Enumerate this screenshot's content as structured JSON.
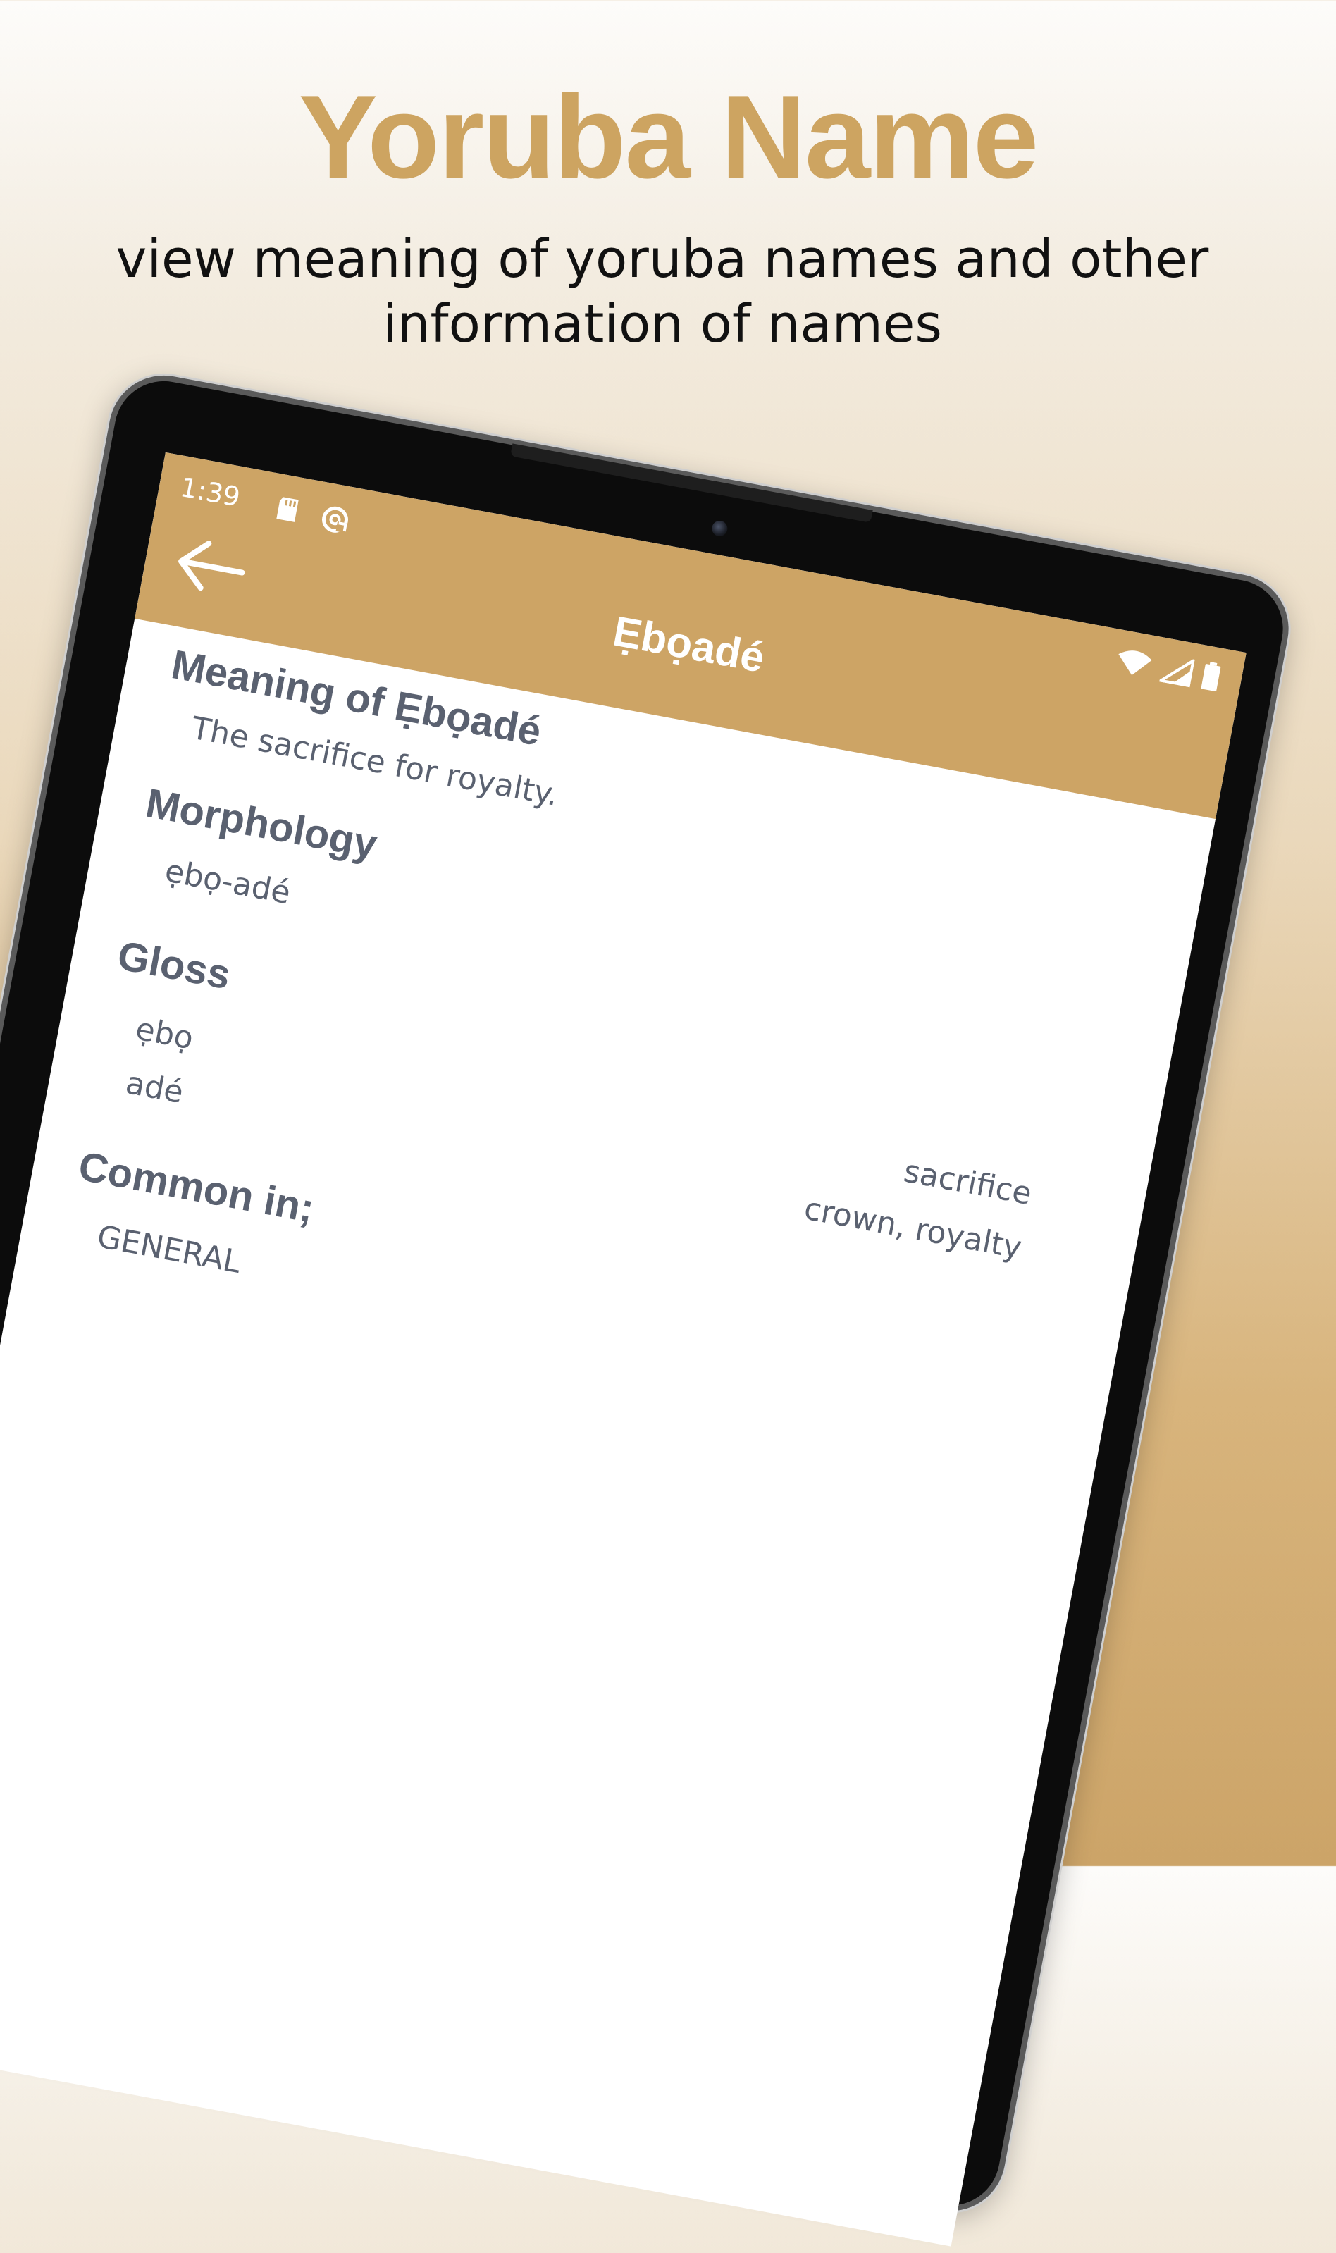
{
  "promo": {
    "title": "Yoruba Name",
    "subtitle": "view meaning of yoruba names and other information of names"
  },
  "status_bar": {
    "time": "1:39",
    "icons": [
      "sd-card-icon",
      "sync-icon",
      "wifi-icon",
      "cell-signal-icon",
      "battery-icon"
    ]
  },
  "app_bar": {
    "title": "Ẹbọadé",
    "back_icon": "arrow-left-icon"
  },
  "details": {
    "meaning_heading": "Meaning of Ẹbọadé",
    "meaning_text": "The sacrifice for royalty.",
    "morphology_heading": "Morphology",
    "morphology_text": "ẹbọ-adé",
    "gloss_heading": "Gloss",
    "gloss": [
      {
        "term": "ẹbọ",
        "meaning": "sacrifice"
      },
      {
        "term": "adé",
        "meaning": "crown, royalty"
      }
    ],
    "common_heading": "Common in;",
    "common_text": "GENERAL"
  },
  "colors": {
    "accent": "#cda465",
    "title_gold": "#cda461",
    "text_gray": "#5a6170"
  }
}
